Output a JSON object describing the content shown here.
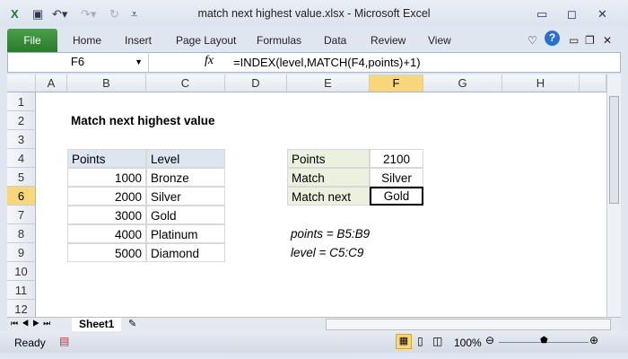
{
  "window": {
    "title": "match next highest value.xlsx  -  Microsoft Excel"
  },
  "ribbon": {
    "tabs": [
      "File",
      "Home",
      "Insert",
      "Page Layout",
      "Formulas",
      "Data",
      "Review",
      "View"
    ]
  },
  "formula_bar": {
    "name_box": "F6",
    "fx": "fx",
    "formula": "=INDEX(level,MATCH(F4,points)+1)"
  },
  "columns": [
    "A",
    "B",
    "C",
    "D",
    "E",
    "F",
    "G",
    "H"
  ],
  "rows": [
    "1",
    "2",
    "3",
    "4",
    "5",
    "6",
    "7",
    "8",
    "9",
    "10",
    "11",
    "12"
  ],
  "sheet": {
    "heading": "Match next highest value",
    "table_headers": [
      "Points",
      "Level"
    ],
    "table": [
      [
        "1000",
        "Bronze"
      ],
      [
        "2000",
        "Silver"
      ],
      [
        "3000",
        "Gold"
      ],
      [
        "4000",
        "Platinum"
      ],
      [
        "5000",
        "Diamond"
      ]
    ],
    "lookup": [
      [
        "Points",
        "2100"
      ],
      [
        "Match",
        "Silver"
      ],
      [
        "Match next",
        "Gold"
      ]
    ],
    "notes": [
      "points = B5:B9",
      "level = C5:C9"
    ]
  },
  "sheet_tabs": [
    "Sheet1"
  ],
  "status": {
    "ready": "Ready",
    "zoom": "100%"
  }
}
